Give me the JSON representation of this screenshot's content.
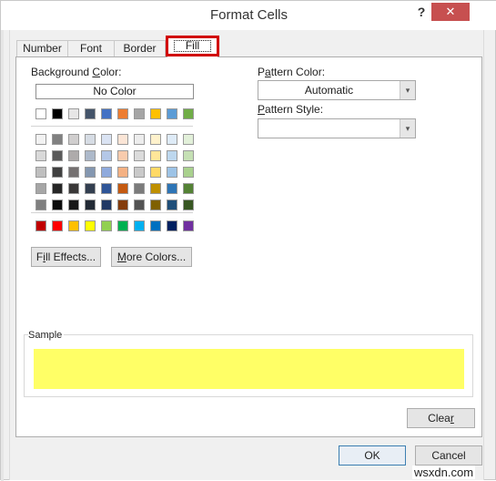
{
  "window": {
    "title": "Format Cells",
    "help_label": "?",
    "close_label": "✕"
  },
  "tabs": [
    {
      "label": "Number",
      "active": false
    },
    {
      "label": "Font",
      "active": false
    },
    {
      "label": "Border",
      "active": false
    },
    {
      "label": "Fill",
      "active": true
    }
  ],
  "background_color": {
    "label_pre": "Background ",
    "label_u": "C",
    "label_post": "olor:",
    "no_color_label": "No Color",
    "theme_row": [
      "#ffffff",
      "#000000",
      "#e7e6e6",
      "#44546a",
      "#4472c4",
      "#ed7d31",
      "#a5a5a5",
      "#ffc000",
      "#5b9bd5",
      "#70ad47"
    ],
    "shades": [
      [
        "#f2f2f2",
        "#808080",
        "#d0cece",
        "#d6dce4",
        "#dae3f3",
        "#fbe5d6",
        "#ededed",
        "#fff2cc",
        "#deebf7",
        "#e2f0d9"
      ],
      [
        "#d9d9d9",
        "#595959",
        "#aeabab",
        "#adb9ca",
        "#b4c7e7",
        "#f8cbad",
        "#dbdbdb",
        "#ffe699",
        "#bdd7ee",
        "#c5e0b4"
      ],
      [
        "#bfbfbf",
        "#404040",
        "#757171",
        "#8497b0",
        "#8faadc",
        "#f4b183",
        "#c9c9c9",
        "#ffd966",
        "#9dc3e6",
        "#a9d18e"
      ],
      [
        "#a6a6a6",
        "#262626",
        "#3a3838",
        "#333f50",
        "#2f5597",
        "#c55a11",
        "#7b7b7b",
        "#bf9000",
        "#2e75b6",
        "#548235"
      ],
      [
        "#7f7f7f",
        "#0d0d0d",
        "#171717",
        "#222a35",
        "#203864",
        "#843c0c",
        "#525252",
        "#7f6000",
        "#1f4e79",
        "#385723"
      ]
    ],
    "standard_row": [
      "#c00000",
      "#ff0000",
      "#ffc000",
      "#ffff00",
      "#92d050",
      "#00b050",
      "#00b0f0",
      "#0070c0",
      "#002060",
      "#7030a0"
    ]
  },
  "buttons": {
    "fill_effects_pre": "F",
    "fill_effects_u": "i",
    "fill_effects_post": "ll Effects...",
    "more_colors_u": "M",
    "more_colors_post": "ore Colors...",
    "clear_pre": "Clea",
    "clear_u": "r",
    "ok": "OK",
    "cancel": "Cancel"
  },
  "pattern": {
    "color_label_pre": "P",
    "color_label_u": "a",
    "color_label_post": "ttern Color:",
    "color_value": "Automatic",
    "style_label_u": "P",
    "style_label_post": "attern Style:",
    "style_value": "",
    "arrow": "▾"
  },
  "sample": {
    "label": "Sample",
    "color": "#ffff66"
  },
  "watermark": "wsxdn.com"
}
